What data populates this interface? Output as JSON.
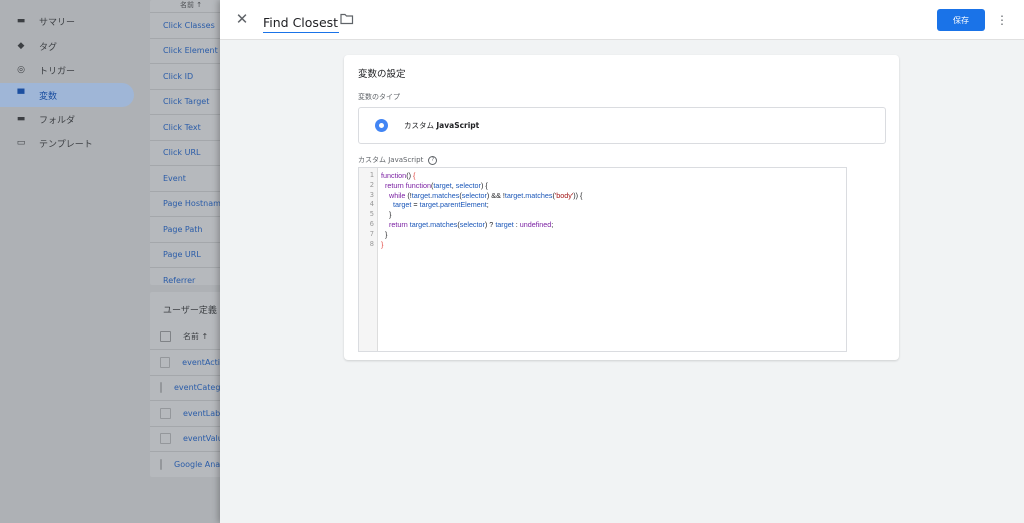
{
  "nav": {
    "items": [
      {
        "label": "サマリー",
        "icon": "summary-icon"
      },
      {
        "label": "タグ",
        "icon": "tag-icon"
      },
      {
        "label": "トリガー",
        "icon": "trigger-icon"
      },
      {
        "label": "変数",
        "icon": "variables-icon",
        "active": true
      },
      {
        "label": "フォルダ",
        "icon": "folder-icon"
      },
      {
        "label": "テンプレート",
        "icon": "template-icon"
      }
    ]
  },
  "builtin_list": {
    "header": "名前 ↑",
    "rows": [
      "Click Classes",
      "Click Element",
      "Click ID",
      "Click Target",
      "Click Text",
      "Click URL",
      "Event",
      "Page Hostname",
      "Page Path",
      "Page URL",
      "Referrer"
    ]
  },
  "user_defined": {
    "title": "ユーザー定義",
    "column": "名前 ↑",
    "rows": [
      "eventAction",
      "eventCategory",
      "eventLabel",
      "eventValue",
      "Google Analytics"
    ]
  },
  "panel": {
    "title": "Find Closest",
    "save_label": "保存",
    "card_title": "変数の設定",
    "type_label": "変数のタイプ",
    "type_name_prefix": "カスタム ",
    "type_name_bold": "JavaScript",
    "code_label": "カスタム JavaScript",
    "code_lines": [
      "function() {",
      "  return function(target, selector) {",
      "    while (!target.matches(selector) && !target.matches('body')) {",
      "      target = target.parentElement;",
      "    }",
      "    return target.matches(selector) ? target : undefined;",
      "  }",
      "}"
    ],
    "line_numbers": [
      "1",
      "2",
      "3",
      "4",
      "5",
      "6",
      "7",
      "8"
    ]
  },
  "colors": {
    "accent": "#1a73e8",
    "panel_bg": "#f1f3f4"
  }
}
